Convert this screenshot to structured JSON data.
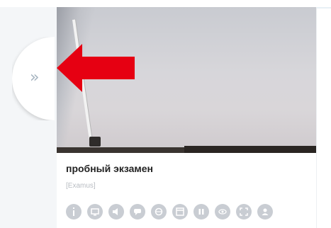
{
  "panel": {
    "exam_title": "пробный экзамен",
    "provider": "[Examus]"
  },
  "expand_tab": {
    "icon": "double-chevron-right-icon",
    "glyph": "»"
  },
  "annotation": {
    "arrow_color": "#e60012",
    "direction": "left"
  },
  "colors": {
    "chevron": "#a6b4c0",
    "control_bg": "#c9cdd3",
    "title": "#222222",
    "provider": "#b8bcc2"
  },
  "controls": [
    {
      "icon": "info-icon"
    },
    {
      "icon": "screen-icon"
    },
    {
      "icon": "sound-icon"
    },
    {
      "icon": "chat-icon"
    },
    {
      "icon": "network-icon"
    },
    {
      "icon": "window-icon"
    },
    {
      "icon": "pause-icon"
    },
    {
      "icon": "eye-icon"
    },
    {
      "icon": "fullscreen-icon"
    },
    {
      "icon": "user-icon"
    }
  ]
}
